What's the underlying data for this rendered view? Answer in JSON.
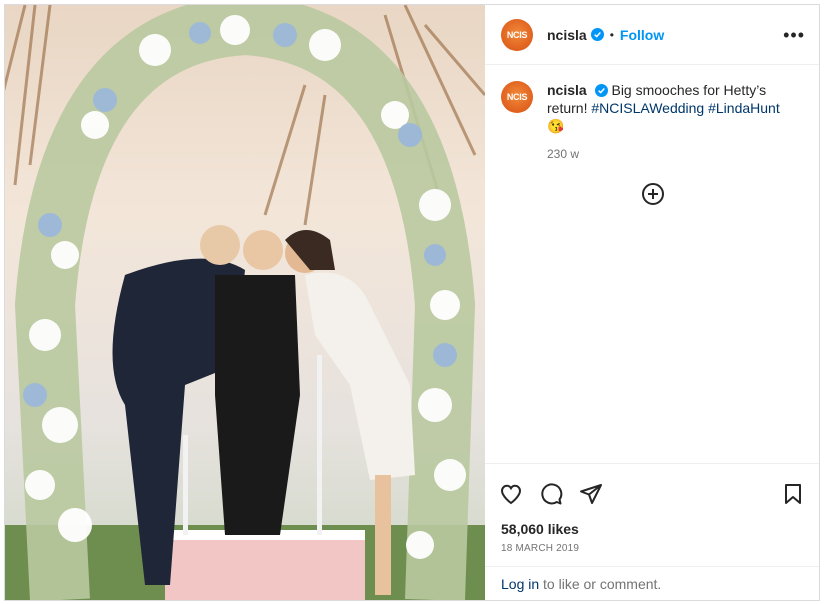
{
  "post": {
    "image_alt": "Wedding arch with flowers, three people kissing a woman's cheeks",
    "header": {
      "avatar_text": "NCIS",
      "username": "ncisla",
      "dot": "•",
      "follow_label": "Follow",
      "more_label": "•••"
    },
    "caption": {
      "username": "ncisla",
      "text": "Big smooches for Hetty’s return!",
      "hashtags": [
        "#NCISLAWedding",
        "#LindaHunt"
      ],
      "emoji": "😘",
      "time_ago": "230 w"
    },
    "actions": {
      "icons": [
        "heart-icon",
        "comment-icon",
        "share-icon",
        "bookmark-icon"
      ]
    },
    "likes": "58,060 likes",
    "date": "18 MARCH 2019",
    "login": {
      "link": "Log in",
      "rest": "to like or comment."
    }
  },
  "colors": {
    "accent": "#0095f6",
    "hashtag": "#00376b",
    "muted": "#737373",
    "avatar": "#e0601e"
  }
}
